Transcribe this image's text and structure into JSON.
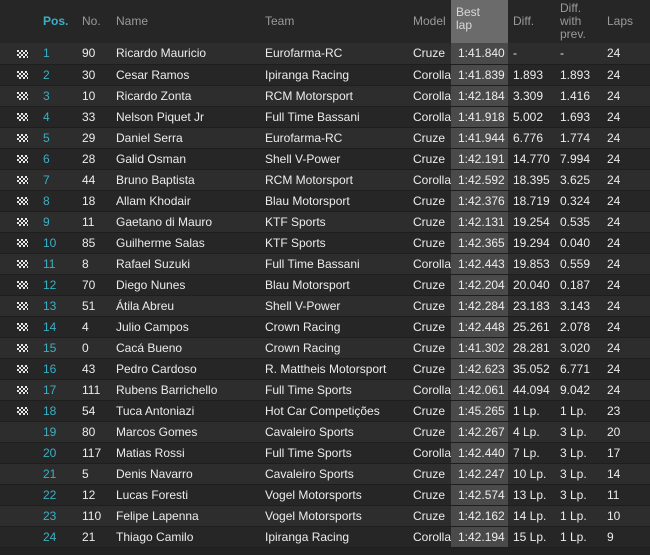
{
  "columns": {
    "pos": "Pos.",
    "no": "No.",
    "name": "Name",
    "team": "Team",
    "model": "Model",
    "best_lap_1": "Best",
    "best_lap_2": "lap",
    "diff": "Diff.",
    "diff_prev_1": "Diff.",
    "diff_prev_2": "with",
    "diff_prev_3": "prev.",
    "laps": "Laps"
  },
  "flag_icon": "checkered-flag-icon",
  "rows": [
    {
      "pos": "1",
      "no": "90",
      "name": "Ricardo Mauricio",
      "team": "Eurofarma-RC",
      "model": "Cruze",
      "best": "1:41.840",
      "diff": "-",
      "prev": "-",
      "laps": "24",
      "flag": true
    },
    {
      "pos": "2",
      "no": "30",
      "name": "Cesar Ramos",
      "team": "Ipiranga Racing",
      "model": "Corolla",
      "best": "1:41.839",
      "diff": "1.893",
      "prev": "1.893",
      "laps": "24",
      "flag": true
    },
    {
      "pos": "3",
      "no": "10",
      "name": "Ricardo Zonta",
      "team": "RCM Motorsport",
      "model": "Corolla",
      "best": "1:42.184",
      "diff": "3.309",
      "prev": "1.416",
      "laps": "24",
      "flag": true
    },
    {
      "pos": "4",
      "no": "33",
      "name": "Nelson Piquet Jr",
      "team": "Full Time Bassani",
      "model": "Corolla",
      "best": "1:41.918",
      "diff": "5.002",
      "prev": "1.693",
      "laps": "24",
      "flag": true
    },
    {
      "pos": "5",
      "no": "29",
      "name": "Daniel Serra",
      "team": "Eurofarma-RC",
      "model": "Cruze",
      "best": "1:41.944",
      "diff": "6.776",
      "prev": "1.774",
      "laps": "24",
      "flag": true
    },
    {
      "pos": "6",
      "no": "28",
      "name": "Galid Osman",
      "team": "Shell V-Power",
      "model": "Cruze",
      "best": "1:42.191",
      "diff": "14.770",
      "prev": "7.994",
      "laps": "24",
      "flag": true
    },
    {
      "pos": "7",
      "no": "44",
      "name": "Bruno Baptista",
      "team": "RCM Motorsport",
      "model": "Corolla",
      "best": "1:42.592",
      "diff": "18.395",
      "prev": "3.625",
      "laps": "24",
      "flag": true
    },
    {
      "pos": "8",
      "no": "18",
      "name": "Allam Khodair",
      "team": "Blau Motorsport",
      "model": "Cruze",
      "best": "1:42.376",
      "diff": "18.719",
      "prev": "0.324",
      "laps": "24",
      "flag": true
    },
    {
      "pos": "9",
      "no": "11",
      "name": "Gaetano di Mauro",
      "team": "KTF Sports",
      "model": "Cruze",
      "best": "1:42.131",
      "diff": "19.254",
      "prev": "0.535",
      "laps": "24",
      "flag": true
    },
    {
      "pos": "10",
      "no": "85",
      "name": "Guilherme Salas",
      "team": "KTF Sports",
      "model": "Cruze",
      "best": "1:42.365",
      "diff": "19.294",
      "prev": "0.040",
      "laps": "24",
      "flag": true
    },
    {
      "pos": "11",
      "no": "8",
      "name": "Rafael Suzuki",
      "team": "Full Time Bassani",
      "model": "Corolla",
      "best": "1:42.443",
      "diff": "19.853",
      "prev": "0.559",
      "laps": "24",
      "flag": true
    },
    {
      "pos": "12",
      "no": "70",
      "name": "Diego Nunes",
      "team": "Blau Motorsport",
      "model": "Cruze",
      "best": "1:42.204",
      "diff": "20.040",
      "prev": "0.187",
      "laps": "24",
      "flag": true
    },
    {
      "pos": "13",
      "no": "51",
      "name": "Átila Abreu",
      "team": "Shell V-Power",
      "model": "Cruze",
      "best": "1:42.284",
      "diff": "23.183",
      "prev": "3.143",
      "laps": "24",
      "flag": true
    },
    {
      "pos": "14",
      "no": "4",
      "name": "Julio Campos",
      "team": "Crown Racing",
      "model": "Cruze",
      "best": "1:42.448",
      "diff": "25.261",
      "prev": "2.078",
      "laps": "24",
      "flag": true
    },
    {
      "pos": "15",
      "no": "0",
      "name": "Cacá Bueno",
      "team": "Crown Racing",
      "model": "Cruze",
      "best": "1:41.302",
      "diff": "28.281",
      "prev": "3.020",
      "laps": "24",
      "flag": true
    },
    {
      "pos": "16",
      "no": "43",
      "name": "Pedro Cardoso",
      "team": "R. Mattheis Motorsport",
      "model": "Cruze",
      "best": "1:42.623",
      "diff": "35.052",
      "prev": "6.771",
      "laps": "24",
      "flag": true
    },
    {
      "pos": "17",
      "no": "111",
      "name": "Rubens Barrichello",
      "team": "Full Time Sports",
      "model": "Corolla",
      "best": "1:42.061",
      "diff": "44.094",
      "prev": "9.042",
      "laps": "24",
      "flag": true
    },
    {
      "pos": "18",
      "no": "54",
      "name": "Tuca Antoniazi",
      "team": "Hot Car Competições",
      "model": "Cruze",
      "best": "1:45.265",
      "diff": "1 Lp.",
      "prev": "1 Lp.",
      "laps": "23",
      "flag": true
    },
    {
      "pos": "19",
      "no": "80",
      "name": "Marcos Gomes",
      "team": "Cavaleiro Sports",
      "model": "Cruze",
      "best": "1:42.267",
      "diff": "4 Lp.",
      "prev": "3 Lp.",
      "laps": "20",
      "flag": false
    },
    {
      "pos": "20",
      "no": "117",
      "name": "Matias Rossi",
      "team": "Full Time Sports",
      "model": "Corolla",
      "best": "1:42.440",
      "diff": "7 Lp.",
      "prev": "3 Lp.",
      "laps": "17",
      "flag": false
    },
    {
      "pos": "21",
      "no": "5",
      "name": "Denis Navarro",
      "team": "Cavaleiro Sports",
      "model": "Cruze",
      "best": "1:42.247",
      "diff": "10 Lp.",
      "prev": "3 Lp.",
      "laps": "14",
      "flag": false
    },
    {
      "pos": "22",
      "no": "12",
      "name": "Lucas Foresti",
      "team": "Vogel Motorsports",
      "model": "Cruze",
      "best": "1:42.574",
      "diff": "13 Lp.",
      "prev": "3 Lp.",
      "laps": "11",
      "flag": false
    },
    {
      "pos": "23",
      "no": "110",
      "name": "Felipe Lapenna",
      "team": "Vogel Motorsports",
      "model": "Cruze",
      "best": "1:42.162",
      "diff": "14 Lp.",
      "prev": "1 Lp.",
      "laps": "10",
      "flag": false
    },
    {
      "pos": "24",
      "no": "21",
      "name": "Thiago Camilo",
      "team": "Ipiranga Racing",
      "model": "Corolla",
      "best": "1:42.194",
      "diff": "15 Lp.",
      "prev": "1 Lp.",
      "laps": "9",
      "flag": false
    }
  ]
}
